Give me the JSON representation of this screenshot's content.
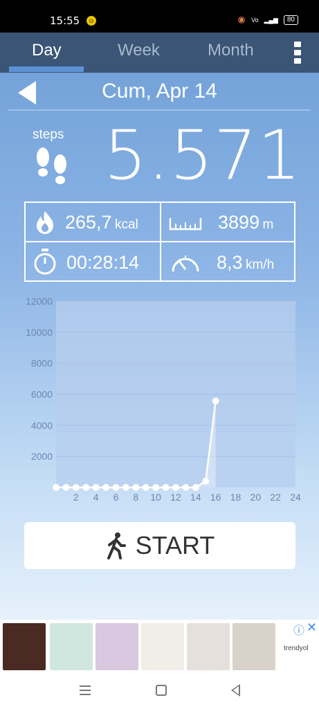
{
  "status": {
    "time": "15:55",
    "battery": "80"
  },
  "tabs": [
    {
      "label": "Day",
      "active": true
    },
    {
      "label": "Week",
      "active": false
    },
    {
      "label": "Month",
      "active": false
    }
  ],
  "date": "Cum, Apr 14",
  "steps": {
    "label": "steps",
    "value": "5.571"
  },
  "stats": {
    "calories": {
      "value": "265,7",
      "unit": "kcal"
    },
    "distance": {
      "value": "3899",
      "unit": "m"
    },
    "duration": {
      "value": "00:28:14"
    },
    "speed": {
      "value": "8,3",
      "unit": "km/h"
    }
  },
  "start_button": {
    "label": "START"
  },
  "ad": {
    "brand": "trendyol"
  },
  "colors": {
    "tabbar": "#3a5576",
    "accent": "#5d92d4",
    "chart_area": "#b7cdee"
  },
  "chart_data": {
    "type": "area",
    "title": "",
    "xlabel": "",
    "ylabel": "",
    "ylim": [
      0,
      12000
    ],
    "xlim": [
      0,
      24
    ],
    "yticks": [
      2000,
      4000,
      6000,
      8000,
      10000,
      12000
    ],
    "xticks": [
      2,
      4,
      6,
      8,
      10,
      12,
      14,
      16,
      18,
      20,
      22,
      24
    ],
    "x": [
      0,
      1,
      2,
      3,
      4,
      5,
      6,
      7,
      8,
      9,
      10,
      11,
      12,
      13,
      14,
      15,
      16
    ],
    "values": [
      0,
      0,
      0,
      0,
      0,
      0,
      0,
      0,
      0,
      0,
      0,
      0,
      0,
      0,
      0,
      400,
      5571
    ],
    "grid": true
  }
}
